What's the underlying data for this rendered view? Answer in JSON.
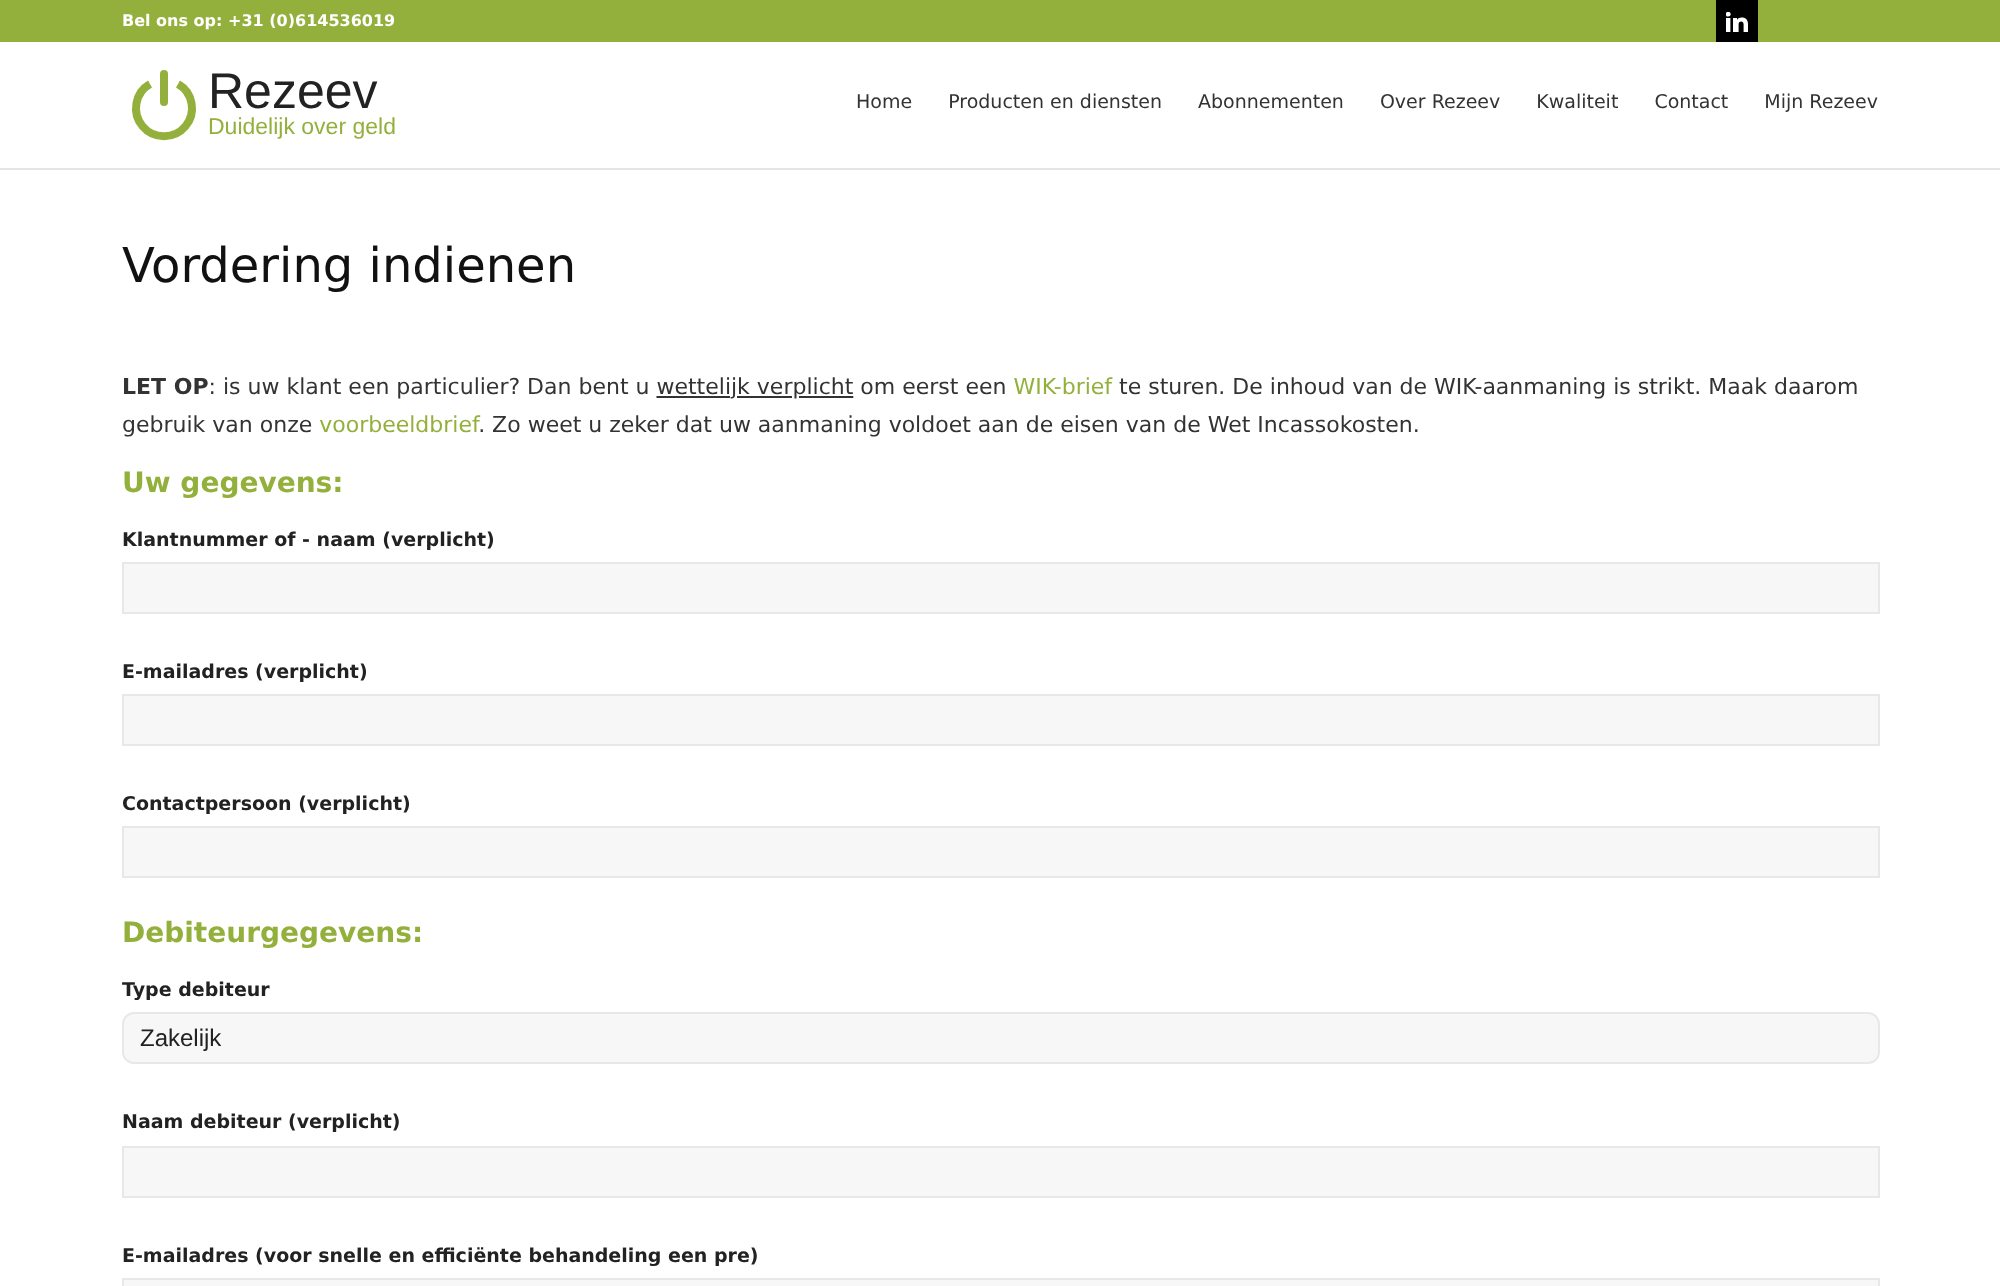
{
  "topbar": {
    "phone": "Bel ons op: +31 (0)614536019"
  },
  "logo": {
    "name": "Rezeev",
    "tagline": "Duidelijk over geld"
  },
  "nav": [
    {
      "label": "Home"
    },
    {
      "label": "Producten en diensten"
    },
    {
      "label": "Abonnementen"
    },
    {
      "label": "Over Rezeev"
    },
    {
      "label": "Kwaliteit"
    },
    {
      "label": "Contact"
    },
    {
      "label": "Mijn Rezeev"
    }
  ],
  "title": "Vordering indienen",
  "intro": [
    {
      "kind": "bold",
      "text": "LET OP"
    },
    {
      "kind": "plain",
      "text": ": is uw klant een particulier? Dan bent u "
    },
    {
      "kind": "link",
      "text": "wettelijk verplicht"
    },
    {
      "kind": "plain",
      "text": " om eerst een "
    },
    {
      "kind": "accent_link",
      "text": "WIK-brief"
    },
    {
      "kind": "plain",
      "text": " te sturen. De inhoud van de WIK-aanmaning is strikt. Maak daarom gebruik van onze "
    },
    {
      "kind": "accent_link",
      "text": "voorbeeldbrief"
    },
    {
      "kind": "plain",
      "text": ". Zo weet u zeker dat uw aanmaning voldoet aan de eisen van de Wet Incassokosten."
    }
  ],
  "sections": [
    {
      "heading": "Uw gegevens:",
      "fields": [
        {
          "kind": "text",
          "label": "Klantnummer of - naam (verplicht)"
        },
        {
          "kind": "text",
          "label": "E-mailadres (verplicht)"
        },
        {
          "kind": "text",
          "label": "Contactpersoon (verplicht)"
        }
      ]
    },
    {
      "heading": "Debiteurgegevens:",
      "fields": [
        {
          "kind": "select",
          "label": "Type debiteur",
          "value": "Zakelijk"
        },
        {
          "kind": "text",
          "label": "Naam debiteur (verplicht)"
        },
        {
          "kind": "text",
          "label": "E-mailadres (voor snelle en efficiënte behandeling een pre)"
        }
      ]
    }
  ]
}
